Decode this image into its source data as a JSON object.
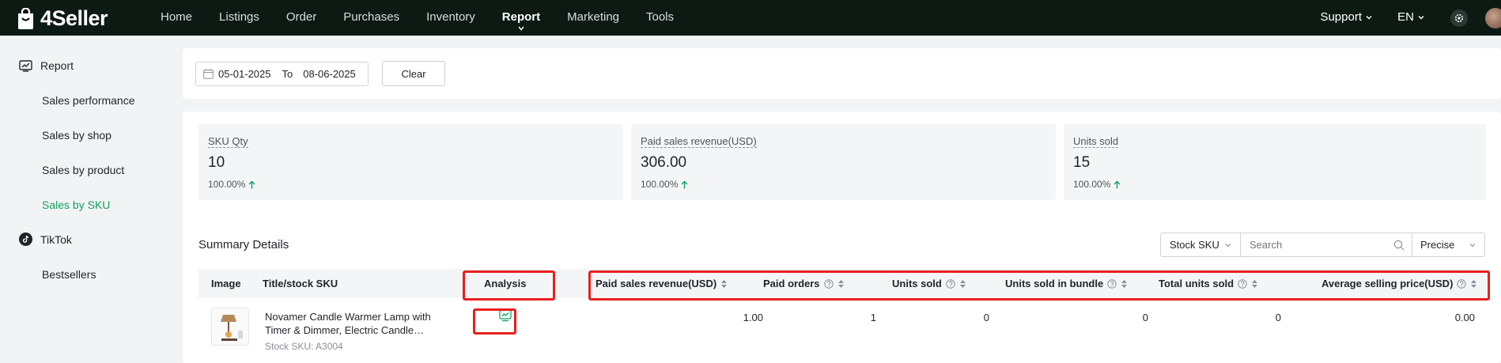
{
  "brand": {
    "name": "4Seller"
  },
  "nav": {
    "items": [
      {
        "label": "Home"
      },
      {
        "label": "Listings"
      },
      {
        "label": "Order"
      },
      {
        "label": "Purchases"
      },
      {
        "label": "Inventory"
      },
      {
        "label": "Report"
      },
      {
        "label": "Marketing"
      },
      {
        "label": "Tools"
      }
    ],
    "active": "Report",
    "support_label": "Support",
    "lang_label": "EN"
  },
  "sidebar": {
    "report_label": "Report",
    "report_items": [
      {
        "label": "Sales performance"
      },
      {
        "label": "Sales by shop"
      },
      {
        "label": "Sales by product"
      },
      {
        "label": "Sales by SKU"
      }
    ],
    "active": "Sales by SKU",
    "tiktok_label": "TikTok",
    "tiktok_items": [
      {
        "label": "Bestsellers"
      }
    ]
  },
  "filters": {
    "date_from": "05-01-2025",
    "to_label": "To",
    "date_to": "08-06-2025",
    "clear_label": "Clear"
  },
  "stats": [
    {
      "label": "SKU Qty",
      "value": "10",
      "change": "100.00%"
    },
    {
      "label": "Paid sales revenue(USD)",
      "value": "306.00",
      "change": "100.00%"
    },
    {
      "label": "Units sold",
      "value": "15",
      "change": "100.00%"
    }
  ],
  "summary": {
    "title": "Summary Details",
    "sku_select_value": "Stock SKU",
    "search_placeholder": "Search",
    "match_value": "Precise"
  },
  "table": {
    "columns": {
      "image": "Image",
      "title": "Title/stock SKU",
      "analysis": "Analysis",
      "paid_revenue": "Paid sales revenue(USD)",
      "paid_orders": "Paid orders",
      "units_sold": "Units sold",
      "units_bundle": "Units sold in bundle",
      "total_units": "Total units sold",
      "avg_price": "Average selling price(USD)"
    },
    "rows": [
      {
        "title": "Novamer Candle Warmer Lamp with Timer & Dimmer, Electric Candle Lamp Warmer...",
        "stock_sku": "Stock SKU: A3004",
        "paid_revenue": "1.00",
        "paid_orders": "1",
        "units_sold": "0",
        "units_bundle": "0",
        "total_units": "0",
        "avg_price": "0.00"
      }
    ]
  },
  "colors": {
    "topbar": "#0d1a14",
    "accent": "#13a05e",
    "highlight": "#e8201e"
  }
}
